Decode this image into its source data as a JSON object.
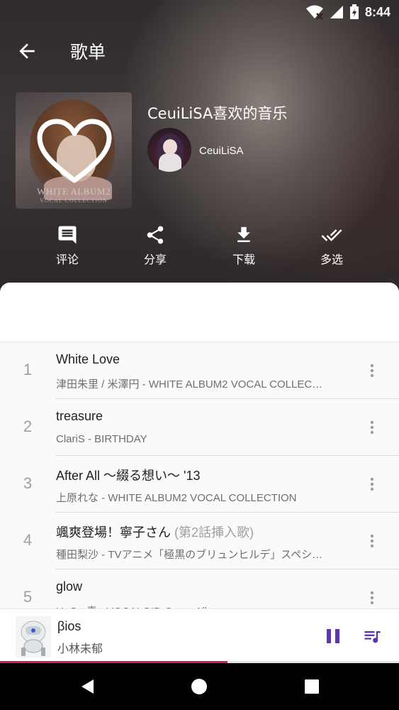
{
  "status_bar": {
    "time": "8:44"
  },
  "toolbar": {
    "title": "歌单"
  },
  "playlist": {
    "title": "CeuiLiSA喜欢的音乐",
    "creator": "CeuiLiSA",
    "cover_text": "WHITE ALBUM2",
    "cover_subtext": "VOCAL COLLECTION"
  },
  "actions": [
    {
      "label": "评论",
      "icon": "comment-icon"
    },
    {
      "label": "分享",
      "icon": "share-icon"
    },
    {
      "label": "下载",
      "icon": "download-icon"
    },
    {
      "label": "多选",
      "icon": "multi-select-icon"
    }
  ],
  "tracks": [
    {
      "num": "1",
      "title": "White Love",
      "note": "",
      "subtitle": "津田朱里 / 米澤円 - WHITE ALBUM2 VOCAL COLLEC…"
    },
    {
      "num": "2",
      "title": "treasure",
      "note": "",
      "subtitle": "ClariS - BIRTHDAY"
    },
    {
      "num": "3",
      "title": "After All ～綴る想い～ '13",
      "note": "",
      "subtitle": "上原れな - WHITE ALBUM2 VOCAL COLLECTION"
    },
    {
      "num": "4",
      "title": "颯爽登場！寧子さん",
      "note": "(第2話挿入歌)",
      "subtitle": "種田梨沙 - TVアニメ「極黒のブリュンヒルデ」スペシ…"
    },
    {
      "num": "5",
      "title": "glow",
      "note": "",
      "subtitle": "H×S - 青 - VOCALOID Cover Album"
    }
  ],
  "now_playing": {
    "title": "βios",
    "artist": "小林未郁",
    "progress": 0.57,
    "accent_color": "#5e35b1",
    "progress_color": "#d81b60"
  }
}
